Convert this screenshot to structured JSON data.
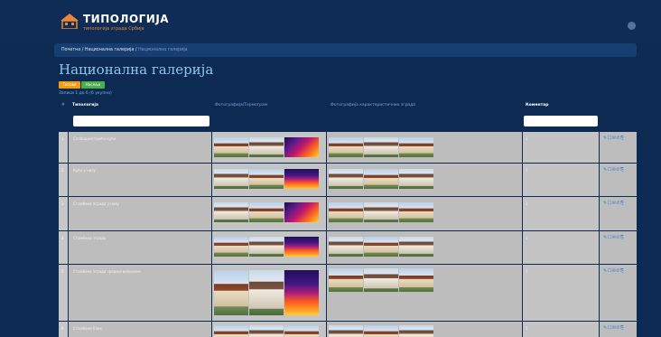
{
  "header": {
    "brand": "ТИПОЛОГИЈА",
    "brand_sub": "типологија зграда Србије"
  },
  "breadcrumb": {
    "home": "Почетна",
    "sep": " / ",
    "section": "Национална галерија",
    "current": "Национална галерија"
  },
  "page": {
    "title": "Национална галерија",
    "btn_orange": "Типови",
    "btn_green": "Насеља",
    "count_text": "Записи 1 до 6 (6 укупно)"
  },
  "columns": {
    "num": "#",
    "typology": "Типологија",
    "photo_thermal": "Фотографија/Термограм",
    "photo_building": "Фотографија карактеристичних зграда",
    "comment": "Коментар"
  },
  "rows": [
    {
      "num": "1",
      "name": "Слободностојећа кућа",
      "comment": "1",
      "actions": "✎☐✉✆⎘"
    },
    {
      "num": "2",
      "name": "Кућа у низу",
      "comment": "1",
      "actions": "✎☐✉✆⎘"
    },
    {
      "num": "3",
      "name": "Стамбена зграда у низу",
      "comment": "1",
      "actions": "✎☐✉✆⎘"
    },
    {
      "num": "4",
      "name": "Стамбена зграда",
      "comment": "1",
      "actions": "✎☐✉✆⎘"
    },
    {
      "num": "5",
      "name": "Стамбена зграда средње величине",
      "comment": "1",
      "actions": "✎☐✉✆⎘"
    },
    {
      "num": "6",
      "name": "Стамбени блок",
      "comment": "1",
      "actions": "✎☐✉✆⎘"
    }
  ],
  "colors": {
    "background": "#0d2a52",
    "title": "#8ec6f0",
    "orange": "#f39c12",
    "green": "#4cae4c",
    "row": "#bdbdbd"
  }
}
